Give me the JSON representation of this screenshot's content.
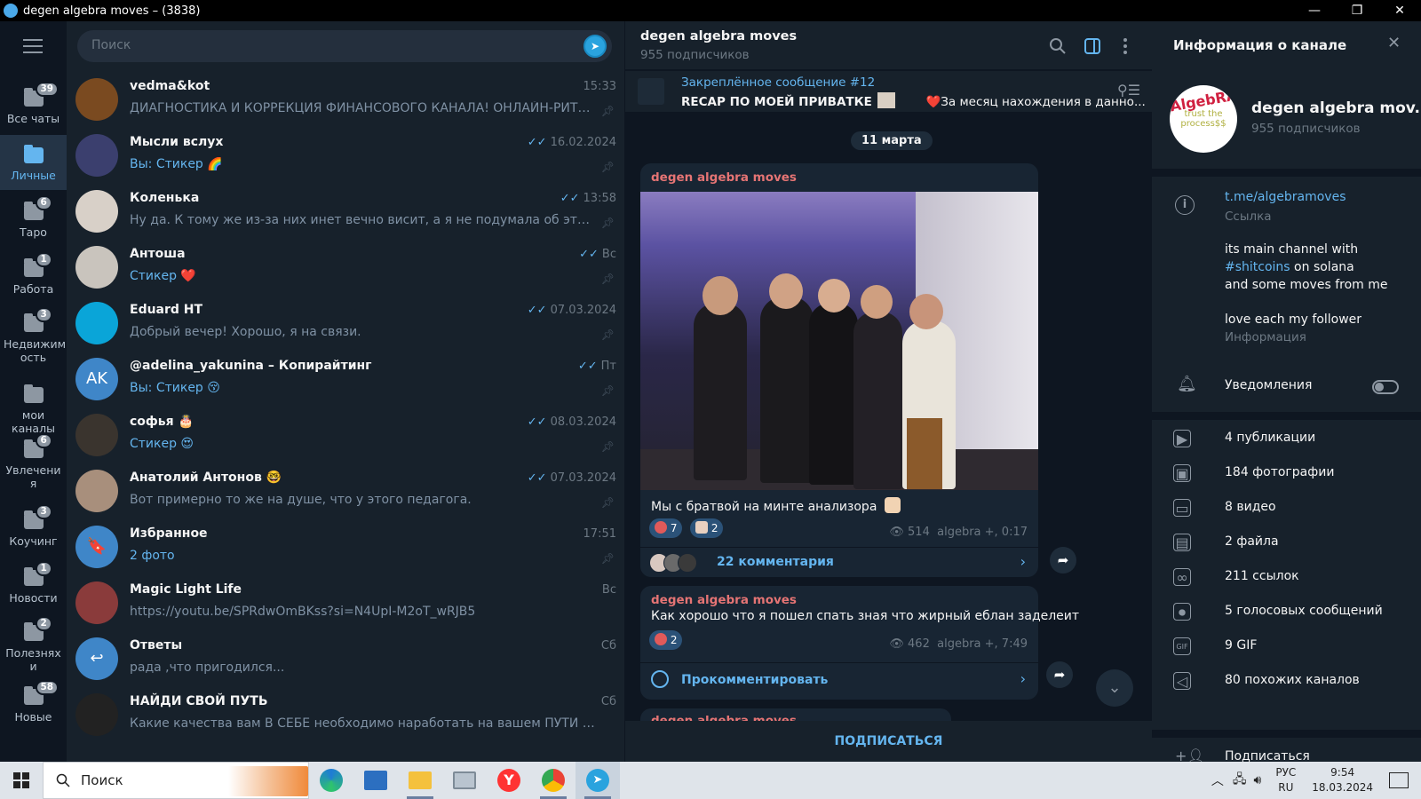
{
  "window": {
    "title": "degen algebra moves – (3838)"
  },
  "folders": [
    {
      "label": "Все чаты",
      "badge": "39",
      "active": false
    },
    {
      "label": "Личные",
      "badge": "",
      "active": true
    },
    {
      "label": "Таро",
      "badge": "6",
      "active": false
    },
    {
      "label": "Работа",
      "badge": "1",
      "active": false
    },
    {
      "label": "Недвижим ость",
      "badge": "3",
      "active": false
    },
    {
      "label": "мои каналы",
      "badge": "",
      "active": false
    },
    {
      "label": "Увлечени я",
      "badge": "6",
      "active": false
    },
    {
      "label": "Коучинг",
      "badge": "3",
      "active": false
    },
    {
      "label": "Новости",
      "badge": "1",
      "active": false
    },
    {
      "label": "Полезнях и",
      "badge": "2",
      "active": false
    },
    {
      "label": "Новые",
      "badge": "58",
      "active": false
    }
  ],
  "search": {
    "placeholder": "Поиск"
  },
  "chats": [
    {
      "name": "vedma&kot",
      "time": "15:33",
      "check": false,
      "sender": "",
      "preview": "ДИАГНОСТИКА И КОРРЕКЦИЯ ФИНАНСОВОГО КАНАЛА! ОНЛАЙН-РИТУА...",
      "avatar_color": "#7a4a20",
      "avatar_text": ""
    },
    {
      "name": "Мысли вслух",
      "time": "16.02.2024",
      "check": true,
      "sender": "Вы: ",
      "preview": "Стикер 🌈",
      "avatar_color": "#3b3f6e",
      "avatar_text": ""
    },
    {
      "name": "Коленька",
      "time": "13:58",
      "check": true,
      "sender": "",
      "preview": "Ну да. К тому же из-за них инет вечно висит, а я не подумала об этом заранее ...",
      "avatar_color": "#d8d0c8",
      "avatar_text": ""
    },
    {
      "name": "Антоша",
      "time": "Вс",
      "check": true,
      "sender": "",
      "preview": "Стикер ❤️",
      "avatar_color": "#c9c4bd",
      "avatar_text": ""
    },
    {
      "name": "Eduard HT",
      "time": "07.03.2024",
      "check": true,
      "sender": "",
      "preview": "Добрый вечер! Хорошо, я на связи.",
      "avatar_color": "#0aa5d8",
      "avatar_text": ""
    },
    {
      "name": "@adelina_yakunina – Копирайтинг",
      "time": "Пт",
      "check": true,
      "sender": "Вы: ",
      "preview": "Стикер 😚",
      "avatar_color": "#3f86c8",
      "avatar_text": "AK"
    },
    {
      "name": "софья 🎂",
      "time": "08.03.2024",
      "check": true,
      "sender": "",
      "preview": "Стикер 😍",
      "avatar_color": "#3a342e",
      "avatar_text": ""
    },
    {
      "name": "Анатолий Антонов 🤓",
      "time": "07.03.2024",
      "check": true,
      "sender": "",
      "preview": "Вот примерно то же на душе, что у этого педагога.",
      "avatar_color": "#a88f7c",
      "avatar_text": ""
    },
    {
      "name": "Избранное",
      "time": "17:51",
      "check": false,
      "sender": "",
      "preview": "2 фото",
      "avatar_color": "#3f86c8",
      "avatar_text": "🔖"
    },
    {
      "name": "Magic Light Life",
      "time": "Вс",
      "check": false,
      "sender": "",
      "preview": "https://youtu.be/SPRdwOmBKss?si=N4UpI-M2oT_wRJB5",
      "avatar_color": "#8a3b3b",
      "avatar_text": ""
    },
    {
      "name": "Ответы",
      "time": "Сб",
      "check": false,
      "sender": "",
      "preview": "рада ,что пригодился...",
      "avatar_color": "#3f86c8",
      "avatar_text": "↩"
    },
    {
      "name": "НАЙДИ СВОЙ ПУТЬ",
      "time": "Сб",
      "check": false,
      "sender": "",
      "preview": "Какие качества вам В СЕБЕ необходимо наработать на вашем ПУТИ к желаемо...",
      "avatar_color": "#222",
      "avatar_text": ""
    }
  ],
  "channel": {
    "name": "degen algebra moves",
    "subs": "955 подписчиков",
    "pinned_title": "Закреплённое сообщение #12",
    "pinned_text": "RECAP ПО МОЕЙ ПРИВАТКЕ",
    "pinned_text2": "❤️За месяц нахождения в данно...",
    "date_chip": "11 марта",
    "subscribe": "ПОДПИСАТЬСЯ"
  },
  "messages": [
    {
      "author": "degen algebra moves",
      "text": "Мы с братвой на минте анализора",
      "react1": "7",
      "react2": "2",
      "views": "514",
      "signature": "algebra +, 0:17",
      "comments": "22 комментария"
    },
    {
      "author": "degen algebra moves",
      "text": "Как хорошо что я пошел спать зная что жирный еблан заделеит",
      "react1": "2",
      "views": "462",
      "signature": "algebra +, 7:49",
      "comments": "Прокомментировать"
    },
    {
      "author": "degen algebra moves"
    }
  ],
  "info": {
    "title": "Информация о канале",
    "name": "degen algebra mov...",
    "subs": "955 подписчиков",
    "avatar_text": "AlgebRA",
    "link": "t.me/algebramoves",
    "link_label": "Ссылка",
    "desc1": "its main channel with",
    "hashtag": "#shitcoins",
    "desc2": " on solana",
    "desc3": "and some moves from me",
    "desc4": "love each my follower",
    "desc_label": "Информация",
    "notifications": "Уведомления",
    "stats": [
      "4 публикации",
      "184 фотографии",
      "8 видео",
      "2 файла",
      "211 ссылок",
      "5 голосовых сообщений",
      "9 GIF",
      "80 похожих каналов"
    ],
    "subscribe": "Подписаться"
  },
  "taskbar": {
    "search": "Поиск",
    "lang1": "РУС",
    "lang2": "RU",
    "time": "9:54",
    "date": "18.03.2024"
  },
  "colors": {
    "accent": "#64b5ef",
    "bg": "#17212b",
    "bg_dark": "#0e1621",
    "author": "#e57474"
  }
}
